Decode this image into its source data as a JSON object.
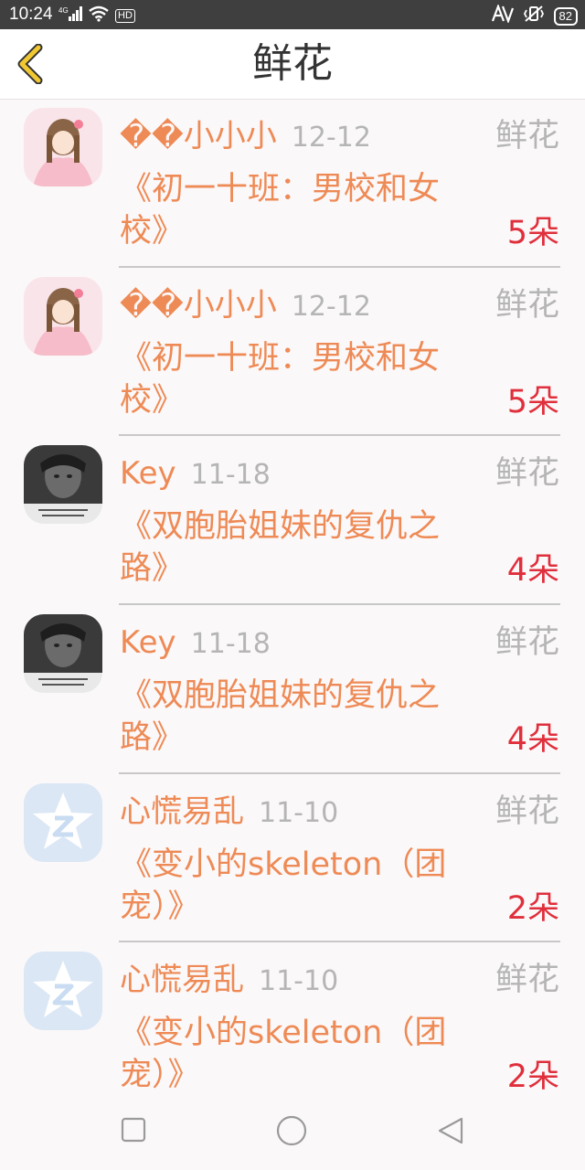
{
  "status_bar": {
    "time": "10:24",
    "network": "4G",
    "hd": "HD",
    "battery": "82"
  },
  "header": {
    "title": "鲜花",
    "back_icon": "chevron-left-icon",
    "accent_color": "#f2c832"
  },
  "items": [
    {
      "user": "��小小小",
      "date": "12-12",
      "type": "鲜花",
      "book": "《初一十班：男校和女校》",
      "count": "5朵",
      "avatar": "girl-avatar"
    },
    {
      "user": "��小小小",
      "date": "12-12",
      "type": "鲜花",
      "book": "《初一十班：男校和女校》",
      "count": "5朵",
      "avatar": "girl-avatar"
    },
    {
      "user": "Key",
      "date": "11-18",
      "type": "鲜花",
      "book": "《双胞胎姐妹的复仇之路》",
      "count": "4朵",
      "avatar": "photo-avatar"
    },
    {
      "user": "Key",
      "date": "11-18",
      "type": "鲜花",
      "book": "《双胞胎姐妹的复仇之路》",
      "count": "4朵",
      "avatar": "photo-avatar"
    },
    {
      "user": "心慌易乱",
      "date": "11-10",
      "type": "鲜花",
      "book": "《变小的skeleton（团宠）》",
      "count": "2朵",
      "avatar": "qzone-avatar"
    },
    {
      "user": "心慌易乱",
      "date": "11-10",
      "type": "鲜花",
      "book": "《变小的skeleton（团宠）》",
      "count": "2朵",
      "avatar": "qzone-avatar"
    }
  ],
  "colors": {
    "name": "#ee8a55",
    "count": "#e02f3c",
    "muted": "#b5b5b5"
  }
}
